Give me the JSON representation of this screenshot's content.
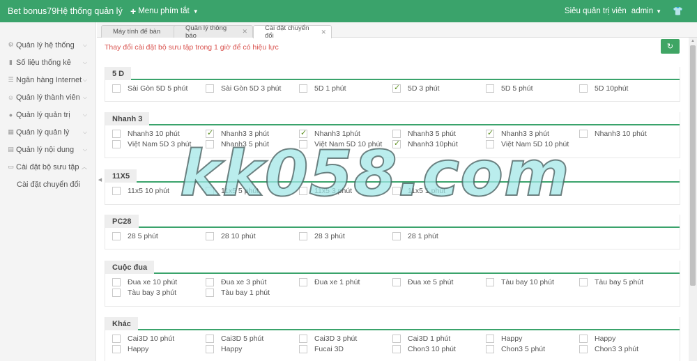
{
  "header": {
    "brand": "Bet bonus79Hệ thống quản lý",
    "quick_menu": "Menu phím tắt",
    "role": "Siêu quản trị viên",
    "user": "admin"
  },
  "sidebar": {
    "items": [
      {
        "icon": "gear-icon",
        "label": "Quản lý hệ thống"
      },
      {
        "icon": "bar-chart-icon",
        "label": "Số liệu thống kê"
      },
      {
        "icon": "list-icon",
        "label": "Ngân hàng Internet"
      },
      {
        "icon": "user-icon",
        "label": "Quản lý thành viên"
      },
      {
        "icon": "admin-icon",
        "label": "Quản lý quản trị"
      },
      {
        "icon": "grid-icon",
        "label": "Quản lý quản lý"
      },
      {
        "icon": "content-icon",
        "label": "Quản lý nội dung"
      },
      {
        "icon": "collection-icon",
        "label": "Cài đặt bộ sưu tập"
      }
    ],
    "sub_item": "Cài đặt chuyển đổi"
  },
  "tabs": [
    {
      "label": "Máy tính để bàn",
      "closable": false
    },
    {
      "label": "Quản lý thông báo",
      "closable": true
    },
    {
      "label": "Cài đặt chuyển đổi",
      "closable": true
    }
  ],
  "notice": "Thay đổi cài đặt bộ sưu tập trong 1 giờ để có hiệu lực",
  "watermark": "kk058.com",
  "colors": {
    "accent": "#3aa36b",
    "notice": "#d9534f",
    "check": "#5c8f1e"
  },
  "sections": [
    {
      "title": "5 D",
      "rows": [
        [
          {
            "label": "Sài Gòn 5D 5 phút",
            "checked": false
          },
          {
            "label": "Sài Gòn 5D 3 phút",
            "checked": false
          },
          {
            "label": "5D 1 phút",
            "checked": false
          },
          {
            "label": "5D 3 phút",
            "checked": true
          },
          {
            "label": "5D 5 phút",
            "checked": false
          },
          {
            "label": "5D 10phút",
            "checked": false
          }
        ]
      ]
    },
    {
      "title": "Nhanh 3",
      "rows": [
        [
          {
            "label": "Nhanh3 10 phút",
            "checked": false
          },
          {
            "label": "Nhanh3 3 phút",
            "checked": true
          },
          {
            "label": "Nhanh3 1phút",
            "checked": true
          },
          {
            "label": "Nhanh3 5 phút",
            "checked": false
          },
          {
            "label": "Nhanh3 3 phút",
            "checked": true
          },
          {
            "label": "Nhanh3 10 phút",
            "checked": false
          }
        ],
        [
          {
            "label": "Việt Nam 5D 3 phút",
            "checked": false
          },
          {
            "label": "Nhanh3 5 phút",
            "checked": false
          },
          {
            "label": "Việt Nam 5D 10 phút",
            "checked": false
          },
          {
            "label": "Nhanh3 10phút",
            "checked": true
          },
          {
            "label": "Việt Nam 5D 10 phút",
            "checked": false
          }
        ]
      ]
    },
    {
      "title": "11X5",
      "rows": [
        [
          {
            "label": "11x5 10 phút",
            "checked": false
          },
          {
            "label": "11x5 5 phút",
            "checked": false
          },
          {
            "label": "11x5 3 phút",
            "checked": false
          },
          {
            "label": "11x5 1 phút",
            "checked": false
          }
        ]
      ]
    },
    {
      "title": "PC28",
      "rows": [
        [
          {
            "label": "28 5 phút",
            "checked": false
          },
          {
            "label": "28 10 phút",
            "checked": false
          },
          {
            "label": "28 3 phút",
            "checked": false
          },
          {
            "label": "28 1 phút",
            "checked": false
          }
        ]
      ]
    },
    {
      "title": "Cuộc đua",
      "rows": [
        [
          {
            "label": "Đua xe 10 phút",
            "checked": false
          },
          {
            "label": "Đua xe 3 phút",
            "checked": false
          },
          {
            "label": "Đua xe 1 phút",
            "checked": false
          },
          {
            "label": "Đua xe 5 phút",
            "checked": false
          },
          {
            "label": "Tàu bay 10 phút",
            "checked": false
          },
          {
            "label": "Tàu bay 5 phút",
            "checked": false
          }
        ],
        [
          {
            "label": "Tàu bay 3 phút",
            "checked": false
          },
          {
            "label": "Tàu bay 1 phút",
            "checked": false
          }
        ]
      ]
    },
    {
      "title": "Khác",
      "rows": [
        [
          {
            "label": "Cai3D 10 phút",
            "checked": false
          },
          {
            "label": "Cai3D 5 phút",
            "checked": false
          },
          {
            "label": "Cai3D 3 phút",
            "checked": false
          },
          {
            "label": "Cai3D 1 phút",
            "checked": false
          },
          {
            "label": "Happy",
            "checked": false
          },
          {
            "label": "Happy",
            "checked": false
          }
        ],
        [
          {
            "label": "Happy",
            "checked": false
          },
          {
            "label": "Happy",
            "checked": false
          },
          {
            "label": "Fucai 3D",
            "checked": false
          },
          {
            "label": "Chon3 10 phút",
            "checked": false
          },
          {
            "label": "Chon3 5 phút",
            "checked": false
          },
          {
            "label": "Chon3 3 phút",
            "checked": false
          }
        ]
      ]
    }
  ]
}
